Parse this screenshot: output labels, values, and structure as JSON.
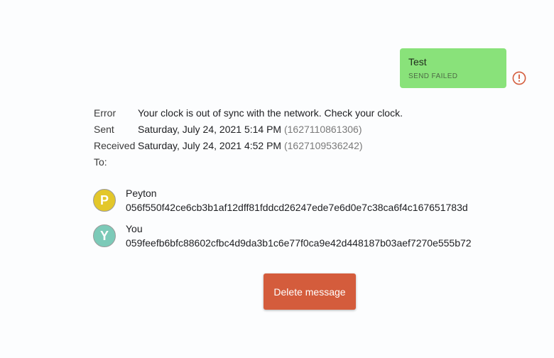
{
  "message": {
    "text": "Test",
    "status": "SEND FAILED",
    "status_icon": "error-circle-icon",
    "bubble_color": "#89e27a",
    "error_color": "#d45c3c"
  },
  "details": {
    "error_label": "Error",
    "error_value": "Your clock is out of sync with the network. Check your clock.",
    "sent_label": "Sent",
    "sent_value": "Saturday, July 24, 2021 5:14 PM",
    "sent_timestamp": "(1627110861306)",
    "received_label": "Received",
    "received_value": "Saturday, July 24, 2021 4:52 PM",
    "received_timestamp": "(1627109536242)",
    "to_label": "To:"
  },
  "recipients": [
    {
      "initial": "P",
      "name": "Peyton",
      "key": "056f550f42ce6cb3b1af12dff81fddcd26247ede7e6d0e7c38ca6f4c167651783d",
      "color": "#e3c72a"
    },
    {
      "initial": "Y",
      "name": "You",
      "key": "059feefb6bfc88602cfbc4d9da3b1c6e77f0ca9e42d448187b03aef7270e555b72",
      "color": "#7ccab8"
    }
  ],
  "actions": {
    "delete_label": "Delete message",
    "delete_color": "#d45c3c"
  }
}
